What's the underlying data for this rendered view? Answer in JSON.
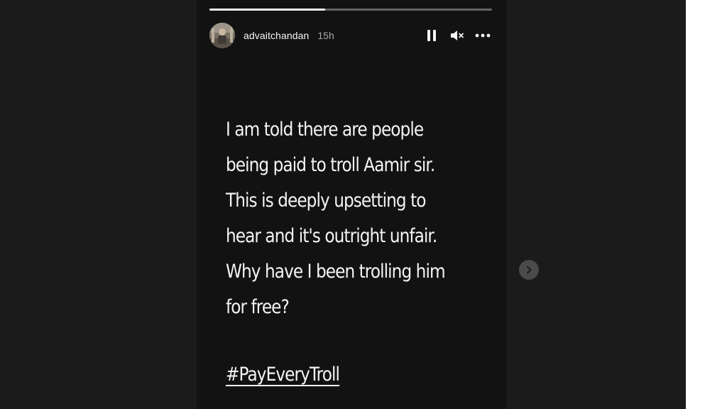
{
  "story": {
    "progress_fraction": 0.41,
    "header": {
      "username": "advaitchandan",
      "timestamp": "15h",
      "controls": {
        "pause_icon": "pause-icon",
        "mute_icon": "muted-speaker-icon",
        "more_icon": "more-options-icon"
      }
    },
    "text_lines": [
      "I am told there are people",
      "being paid to troll Aamir sir.",
      "This is deeply upsetting to",
      "hear and it's outright unfair.",
      "Why have I been trolling him",
      "for free?"
    ],
    "hashtag": "#PayEveryTroll"
  },
  "navigation": {
    "next_icon": "chevron-right-icon"
  },
  "colors": {
    "page_background": "#1b1b1b",
    "story_background": "#121212",
    "text": "#f4f4f4",
    "muted_text": "#a8a8a8"
  }
}
